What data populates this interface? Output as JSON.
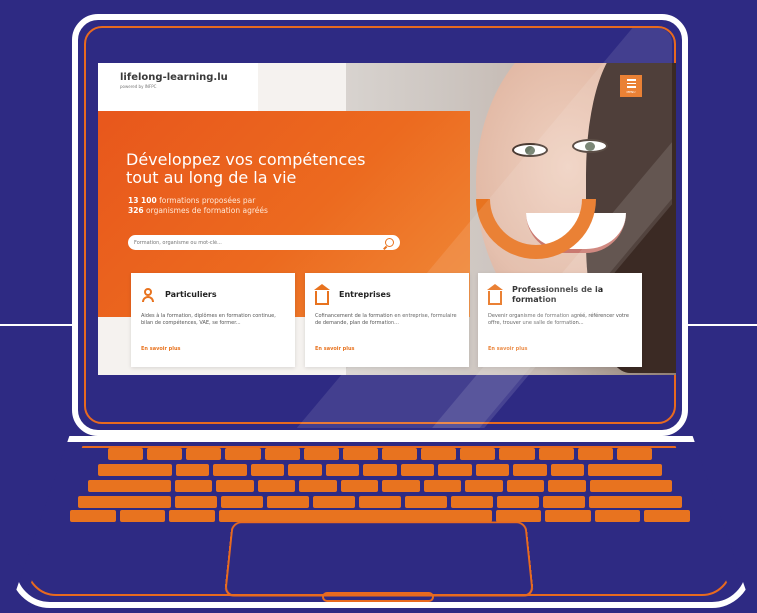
{
  "brand": {
    "logo_text": "lifelong-learning.lu",
    "logo_sub": "powered by INFPC",
    "accent_color": "#e8731f",
    "bg_color": "#2e2a83"
  },
  "header": {
    "menu_label": "MENU",
    "menu_icon": "hamburger-icon"
  },
  "hero": {
    "title_line1": "Développez vos compétences",
    "title_line2": "tout au long de la vie",
    "stat1_num": "13 100",
    "stat1_text": " formations proposées par",
    "stat2_num": "326",
    "stat2_text": " organismes de formation agréés"
  },
  "search": {
    "placeholder": "Formation, organisme ou mot-clé...",
    "icon": "search-icon"
  },
  "cards": [
    {
      "title": "Particuliers",
      "description": "Aides à la formation, diplômes en formation continue, bilan de compétences, VAE, se former...",
      "link": "En savoir plus",
      "icon": "person-icon"
    },
    {
      "title": "Entreprises",
      "description": "Cofinancement de la formation en entreprise, formulaire de demande, plan de formation...",
      "link": "En savoir plus",
      "icon": "house-icon"
    },
    {
      "title": "Professionnels de la formation",
      "description": "Devenir organisme de formation agréé, référencer votre offre, trouver une salle de formation...",
      "link": "En savoir plus",
      "icon": "house-icon"
    }
  ]
}
